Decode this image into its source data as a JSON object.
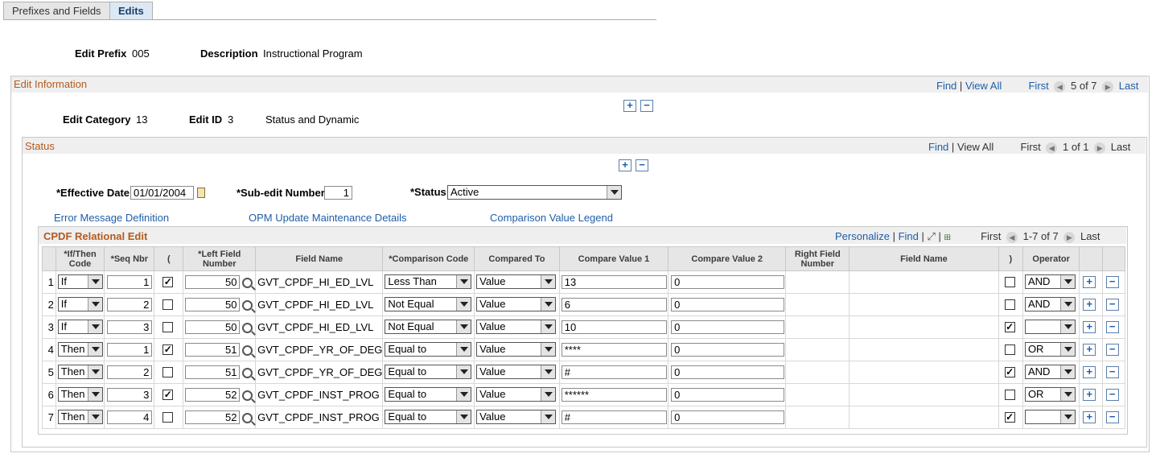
{
  "tabs": [
    {
      "label": "Prefixes and Fields"
    },
    {
      "label": "Edits"
    }
  ],
  "header": {
    "edit_prefix_label": "Edit Prefix",
    "edit_prefix_value": "005",
    "description_label": "Description",
    "description_value": "Instructional Program"
  },
  "edit_info": {
    "title": "Edit Information",
    "find": "Find",
    "sep": "|",
    "view_all": "View All",
    "first": "First",
    "count": "5 of 7",
    "last": "Last",
    "category_label": "Edit Category",
    "category_value": "13",
    "edit_id_label": "Edit ID",
    "edit_id_value": "3",
    "edit_desc": "Status and Dynamic"
  },
  "status_box": {
    "title": "Status",
    "find": "Find",
    "sep": "|",
    "view_all": "View All",
    "first": "First",
    "count": "1 of 1",
    "last": "Last",
    "eff_date_label": "*Effective Date",
    "eff_date_value": "01/01/2004",
    "subedit_label": "*Sub-edit Number",
    "subedit_value": "1",
    "status_label": "*Status",
    "status_value": "Active"
  },
  "links": {
    "error_msg": "Error Message Definition",
    "opm": "OPM Update Maintenance Details",
    "legend": "Comparison Value Legend"
  },
  "grid": {
    "title": "CPDF Relational Edit",
    "personalize": "Personalize",
    "find": "Find",
    "sep": "|",
    "first": "First",
    "count": "1-7 of 7",
    "last": "Last",
    "columns": [
      "*If/Then Code",
      "*Seq Nbr",
      "(",
      "*Left Field Number",
      "Field Name",
      "*Comparison Code",
      "Compared To",
      "Compare Value 1",
      "Compare Value 2",
      "Right Field Number",
      "Field Name",
      ")",
      "Operator"
    ],
    "rows": [
      {
        "num": "1",
        "code": "If",
        "seq": "1",
        "open": true,
        "left": "50",
        "field": "GVT_CPDF_HI_ED_LVL",
        "comp": "Less Than",
        "to": "Value",
        "v1": "13",
        "v2": "0",
        "close": false,
        "op": "AND"
      },
      {
        "num": "2",
        "code": "If",
        "seq": "2",
        "open": false,
        "left": "50",
        "field": "GVT_CPDF_HI_ED_LVL",
        "comp": "Not Equal",
        "to": "Value",
        "v1": "6",
        "v2": "0",
        "close": false,
        "op": "AND"
      },
      {
        "num": "3",
        "code": "If",
        "seq": "3",
        "open": false,
        "left": "50",
        "field": "GVT_CPDF_HI_ED_LVL",
        "comp": "Not Equal",
        "to": "Value",
        "v1": "10",
        "v2": "0",
        "close": true,
        "op": ""
      },
      {
        "num": "4",
        "code": "Then",
        "seq": "1",
        "open": true,
        "left": "51",
        "field": "GVT_CPDF_YR_OF_DEG",
        "comp": "Equal to",
        "to": "Value",
        "v1": "****",
        "v2": "0",
        "close": false,
        "op": "OR"
      },
      {
        "num": "5",
        "code": "Then",
        "seq": "2",
        "open": false,
        "left": "51",
        "field": "GVT_CPDF_YR_OF_DEG",
        "comp": "Equal to",
        "to": "Value",
        "v1": "#",
        "v2": "0",
        "close": true,
        "op": "AND"
      },
      {
        "num": "6",
        "code": "Then",
        "seq": "3",
        "open": true,
        "left": "52",
        "field": "GVT_CPDF_INST_PROG",
        "comp": "Equal to",
        "to": "Value",
        "v1": "******",
        "v2": "0",
        "close": false,
        "op": "OR"
      },
      {
        "num": "7",
        "code": "Then",
        "seq": "4",
        "open": false,
        "left": "52",
        "field": "GVT_CPDF_INST_PROG",
        "comp": "Equal to",
        "to": "Value",
        "v1": "#",
        "v2": "0",
        "close": true,
        "op": ""
      }
    ]
  },
  "icons": {
    "add": "+",
    "remove": "−",
    "prev": "◀",
    "next": "▶",
    "download": "⊞",
    "zoom": "⤢",
    "check": "✓"
  },
  "colors": {
    "section_title": "#b25b1e",
    "link": "#1f5ea8"
  }
}
